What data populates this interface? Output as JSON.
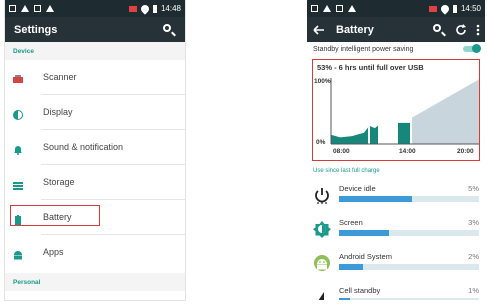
{
  "left": {
    "status_time": "14:48",
    "title": "Settings",
    "section_device": "Device",
    "items": [
      {
        "label": "Scanner",
        "icon": "scanner-icon"
      },
      {
        "label": "Display",
        "icon": "display-icon"
      },
      {
        "label": "Sound & notification",
        "icon": "bell-icon"
      },
      {
        "label": "Storage",
        "icon": "storage-icon"
      },
      {
        "label": "Battery",
        "icon": "battery-icon"
      },
      {
        "label": "Apps",
        "icon": "android-icon"
      }
    ],
    "section_personal": "Personal",
    "colors": {
      "accent": "#1a9a8c",
      "highlight": "#d63b3b"
    }
  },
  "right": {
    "status_time": "14:50",
    "title": "Battery",
    "standby_label": "Standby intelligent power saving",
    "standby_on": true,
    "graph_title": "53% - 6 hrs until full over USB",
    "y_top": "100%",
    "y_bottom": "0%",
    "x_ticks": [
      "08:00",
      "14:00",
      "20:00"
    ],
    "usage_link": "Use since last full charge",
    "usage": [
      {
        "name": "Device idle",
        "pct": "5%",
        "level": 0.52,
        "icon": "power-icon"
      },
      {
        "name": "Screen",
        "pct": "3%",
        "level": 0.36,
        "icon": "brightness-icon"
      },
      {
        "name": "Android System",
        "pct": "2%",
        "level": 0.17,
        "icon": "android-system-icon"
      },
      {
        "name": "Cell standby",
        "pct": "1%",
        "level": 0.08,
        "icon": "signal-icon"
      }
    ],
    "colors": {
      "bar": "#3d9ad9",
      "graph": "#15887b",
      "forecast": "#c9d5dc"
    }
  },
  "chart_data": {
    "type": "area",
    "title": "53% - 6 hrs until full over USB",
    "x": [
      "08:00",
      "14:00",
      "20:00"
    ],
    "ylim": [
      0,
      100
    ],
    "series": [
      {
        "values": [
          0,
          20,
          28,
          32,
          53,
          100
        ]
      }
    ]
  }
}
